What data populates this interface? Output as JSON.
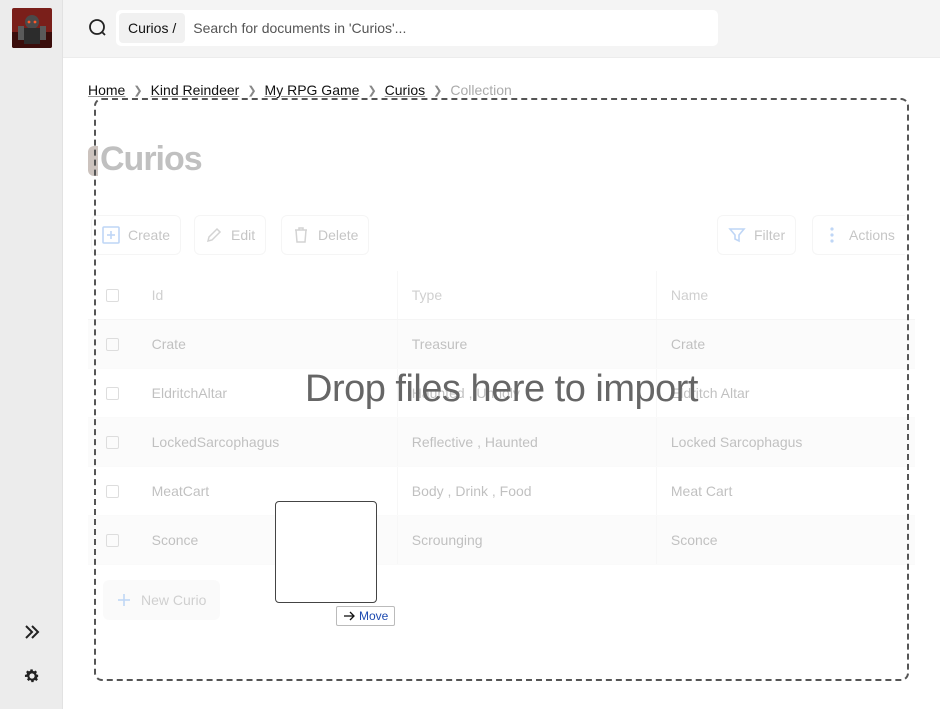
{
  "sidebar": {
    "avatar_icon": "character-avatar",
    "expand_icon": "double-chevron-right-icon",
    "settings_icon": "gear-icon"
  },
  "search": {
    "scope": "Curios /",
    "placeholder": "Search for documents in 'Curios'..."
  },
  "breadcrumb": [
    "Home",
    "Kind Reindeer",
    "My RPG Game",
    "Curios",
    "Collection"
  ],
  "page": {
    "title": "Curios"
  },
  "toolbar": {
    "create": "Create",
    "edit": "Edit",
    "delete": "Delete",
    "filter": "Filter",
    "actions": "Actions"
  },
  "table": {
    "columns": [
      "Id",
      "Type",
      "Name"
    ],
    "rows": [
      [
        "Crate",
        "Treasure",
        "Crate"
      ],
      [
        "EldritchAltar",
        "Haunted , Unholy",
        "Eldritch Altar"
      ],
      [
        "LockedSarcophagus",
        "Reflective , Haunted",
        "Locked Sarcophagus"
      ],
      [
        "MeatCart",
        "Body , Drink , Food",
        "Meat Cart"
      ],
      [
        "Sconce",
        "Scrounging",
        "Sconce"
      ]
    ]
  },
  "new_row": {
    "label": "New Curio"
  },
  "drop_overlay": {
    "text": "Drop files here to import"
  },
  "drag_tooltip": {
    "label": "Move"
  }
}
